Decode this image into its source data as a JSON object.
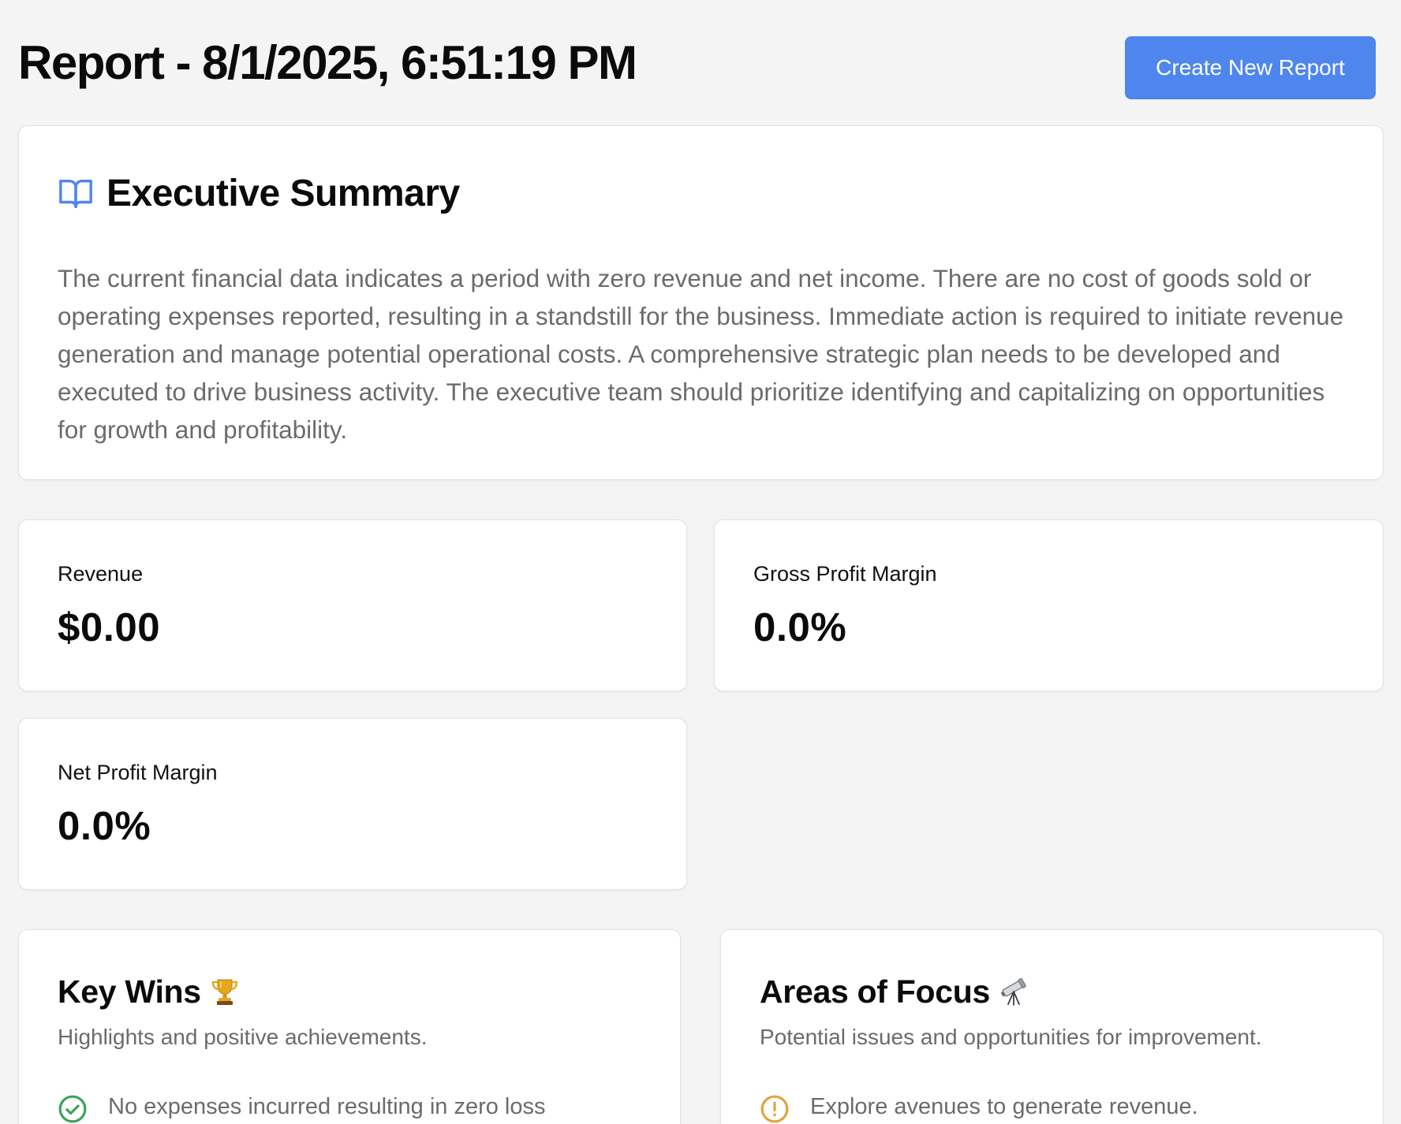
{
  "header": {
    "title": "Report - 8/1/2025, 6:51:19 PM",
    "create_button_label": "Create New Report"
  },
  "summary": {
    "icon": "book-open-icon",
    "title": "Executive Summary",
    "text": "The current financial data indicates a period with zero revenue and net income. There are no cost of goods sold or operating expenses reported, resulting in a standstill for the business. Immediate action is required to initiate revenue generation and manage potential operational costs. A comprehensive strategic plan needs to be developed and executed to drive business activity. The executive team should prioritize identifying and capitalizing on opportunities for growth and profitability."
  },
  "metrics": {
    "revenue": {
      "label": "Revenue",
      "value": "$0.00"
    },
    "gross_margin": {
      "label": "Gross Profit Margin",
      "value": "0.0%"
    },
    "net_margin": {
      "label": "Net Profit Margin",
      "value": "0.0%"
    }
  },
  "key_wins": {
    "title": "Key Wins",
    "icon": "trophy-icon",
    "subtitle": "Highlights and positive achievements.",
    "items": [
      {
        "icon": "check-circle-icon",
        "text": "No expenses incurred resulting in zero loss"
      }
    ]
  },
  "areas_of_focus": {
    "title": "Areas of Focus",
    "icon": "telescope-icon",
    "subtitle": "Potential issues and opportunities for improvement.",
    "items": [
      {
        "icon": "alert-circle-icon",
        "text": "Explore avenues to generate revenue."
      }
    ]
  },
  "colors": {
    "accent": "#4f86ee",
    "success": "#3aa35a",
    "warning": "#e3a33a",
    "muted_text": "#6b6b6b",
    "background": "#f4f4f4"
  }
}
